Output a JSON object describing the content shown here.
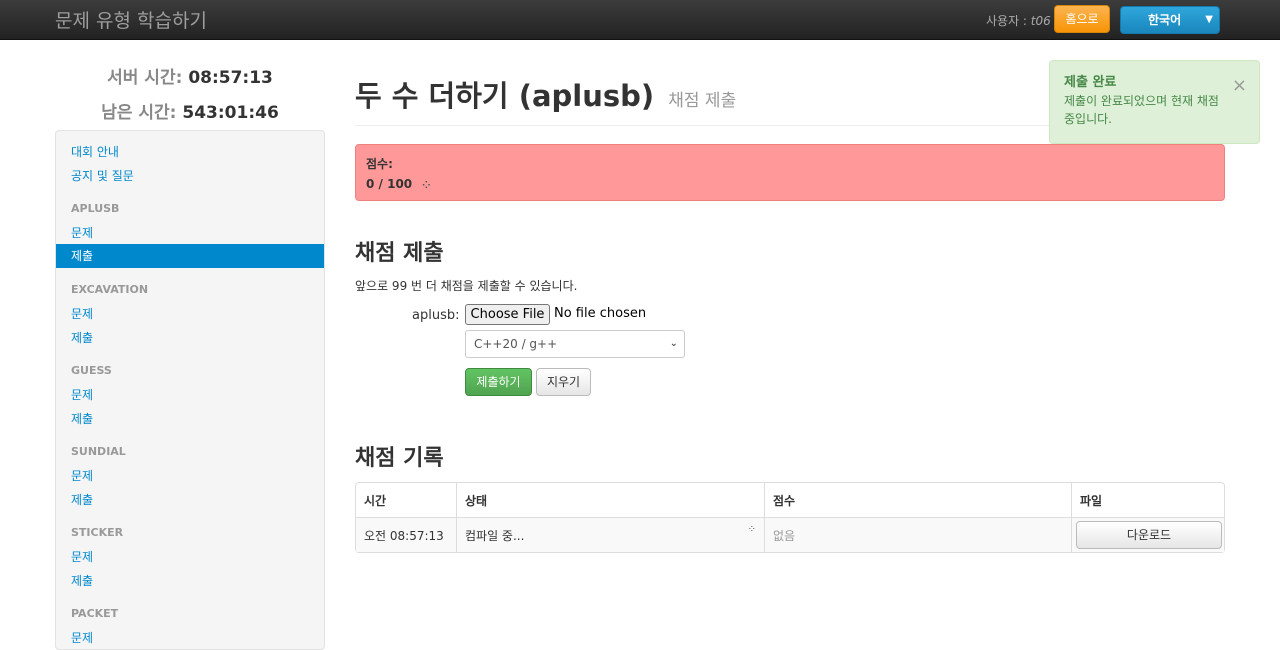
{
  "nav": {
    "brand": "문제 유형 학습하기",
    "user_prefix": "사용자 : ",
    "user_name": "t06",
    "home_button": "홈으로",
    "language": "한국어"
  },
  "sidebar": {
    "server_time_label": "서버 시간:",
    "server_time": "08:57:13",
    "remaining_label": "남은 시간:",
    "remaining_time": "543:01:46",
    "items": [
      {
        "label": "대회 안내"
      },
      {
        "label": "공지 및 질문"
      }
    ],
    "tasks": [
      {
        "name": "APLUSB",
        "problem": "문제",
        "submit": "제출"
      },
      {
        "name": "EXCAVATION",
        "problem": "문제",
        "submit": "제출"
      },
      {
        "name": "GUESS",
        "problem": "문제",
        "submit": "제출"
      },
      {
        "name": "SUNDIAL",
        "problem": "문제",
        "submit": "제출"
      },
      {
        "name": "STICKER",
        "problem": "문제",
        "submit": "제출"
      },
      {
        "name": "PACKET",
        "problem": "문제"
      }
    ]
  },
  "main": {
    "title": "두 수 더하기 (aplusb)",
    "subtitle": "채점 제출",
    "score_label": "점수:",
    "score_value": "0 / 100",
    "submit_heading": "채점 제출",
    "remaining_text": "앞으로 99 번 더 채점을 제출할 수 있습니다.",
    "file_label": "aplusb:",
    "choose_file": "Choose File",
    "no_file": "No file chosen",
    "language_select": "C++20 / g++",
    "submit_button": "제출하기",
    "clear_button": "지우기",
    "history_heading": "채점 기록",
    "history_headers": [
      "시간",
      "상태",
      "점수",
      "파일"
    ],
    "history_rows": [
      {
        "time": "오전 08:57:13",
        "status": "컴파일 중...",
        "score": "없음",
        "file": "다운로드"
      }
    ]
  },
  "toast": {
    "title": "제출 완료",
    "message": "제출이 완료되었으며 현재 채점 중입니다.",
    "close": "×"
  }
}
